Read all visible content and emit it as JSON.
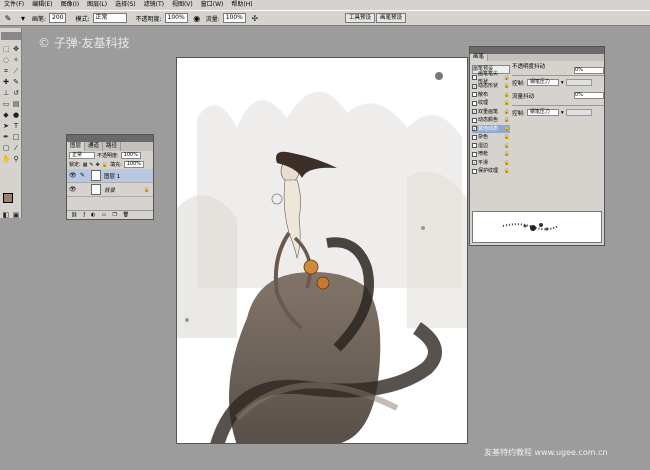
{
  "menubar": {
    "items": [
      "文件(F)",
      "编辑(E)",
      "图像(I)",
      "图层(L)",
      "选择(S)",
      "滤镜(T)",
      "视图(V)",
      "窗口(W)",
      "帮助(H)"
    ]
  },
  "optionbar": {
    "brush_label": "画笔:",
    "brush_size": "200",
    "mode_label": "模式:",
    "mode_value": "正常",
    "opacity_label": "不透明度:",
    "opacity_value": "100%",
    "flow_label": "流量:",
    "flow_value": "100%"
  },
  "top_tabs": [
    "工具预设",
    "画笔预设"
  ],
  "watermark": "© 子弹·友基科技",
  "layers_panel": {
    "tabs": [
      "图层",
      "通道",
      "路径"
    ],
    "blend_mode": "正常",
    "opacity_label": "不透明度:",
    "opacity_value": "100%",
    "lock_label": "锁定:",
    "fill_label": "填充:",
    "fill_value": "100%",
    "layers": [
      {
        "name": "图层 1"
      },
      {
        "name": "背景"
      }
    ]
  },
  "brushes_panel": {
    "tab": "画笔",
    "presets_label": "画笔预设",
    "items": [
      {
        "label": "画笔笔尖形状",
        "checked": false,
        "selected": false
      },
      {
        "label": "动态形状",
        "checked": true,
        "selected": false
      },
      {
        "label": "散布",
        "checked": false,
        "selected": false
      },
      {
        "label": "纹理",
        "checked": false,
        "selected": false
      },
      {
        "label": "双重画笔",
        "checked": true,
        "selected": false
      },
      {
        "label": "动态颜色",
        "checked": false,
        "selected": false
      },
      {
        "label": "其他动态",
        "checked": true,
        "selected": true
      },
      {
        "label": "杂色",
        "checked": false,
        "selected": false
      },
      {
        "label": "湿边",
        "checked": false,
        "selected": false
      },
      {
        "label": "喷枪",
        "checked": false,
        "selected": false
      },
      {
        "label": "平滑",
        "checked": true,
        "selected": false
      },
      {
        "label": "保护纹理",
        "checked": false,
        "selected": false
      }
    ],
    "opacity_jitter_label": "不透明度抖动",
    "opacity_jitter_value": "0%",
    "control_label": "控制:",
    "control_value": "钢笔压力",
    "flow_jitter_label": "流量抖动",
    "flow_jitter_value": "0%",
    "control2_value": "钢笔压力"
  },
  "footer": "友基特约教程 www.ugee.com.cn"
}
